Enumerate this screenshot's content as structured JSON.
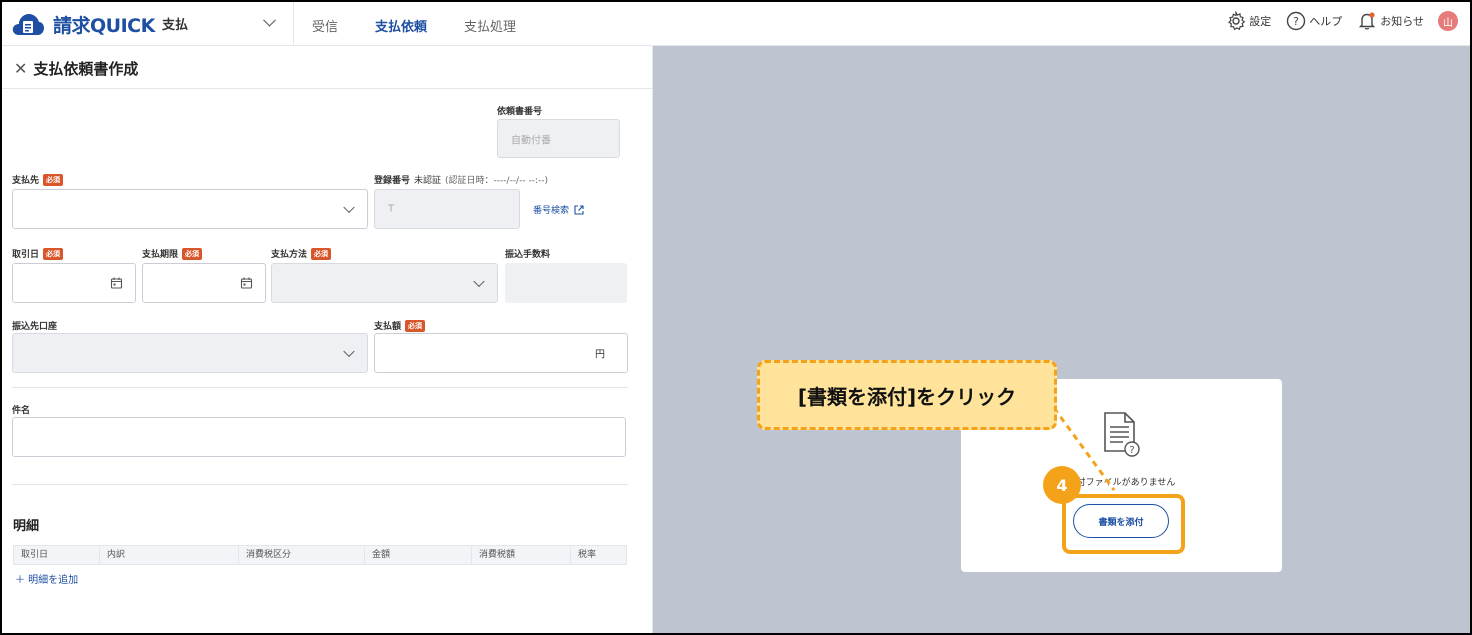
{
  "app": {
    "logo_text": "請求QUICK",
    "module": "支払"
  },
  "nav": {
    "items": [
      "受信",
      "支払依頼",
      "支払処理"
    ],
    "active_index": 1
  },
  "header_actions": {
    "settings": "設定",
    "help": "ヘルプ",
    "notifications": "お知らせ",
    "avatar": "山"
  },
  "form": {
    "title": "支払依頼書作成",
    "request_number_label": "依頼書番号",
    "request_number_value": "自動付番",
    "payee_label": "支払先",
    "required_badge": "必須",
    "registration_label": "登録番号",
    "registration_status": "未認証",
    "registration_note": "(認証日時：----/--/-- --:--)",
    "registration_prefix": "T",
    "number_search_link": "番号検索",
    "transaction_date_label": "取引日",
    "payment_deadline_label": "支払期限",
    "payment_method_label": "支払方法",
    "transfer_fee_label": "振込手数料",
    "transfer_account_label": "振込先口座",
    "payment_amount_label": "支払額",
    "currency_unit": "円",
    "subject_label": "件名",
    "details_section": "明細",
    "details_columns": [
      "取引日",
      "内訳",
      "消費税区分",
      "金額",
      "消費税額",
      "税率"
    ],
    "add_detail_link": "＋ 明細を追加"
  },
  "preview": {
    "empty_text": "添付ファイルがありません",
    "attach_button": "書類を添付"
  },
  "guide": {
    "step_number": "4",
    "callout_text": "[書類を添付]をクリック",
    "accent_color": "#f5a21b"
  },
  "colors": {
    "brand": "#1e4fa3",
    "required": "#d9562b",
    "preview_bg": "#bec5d1"
  }
}
